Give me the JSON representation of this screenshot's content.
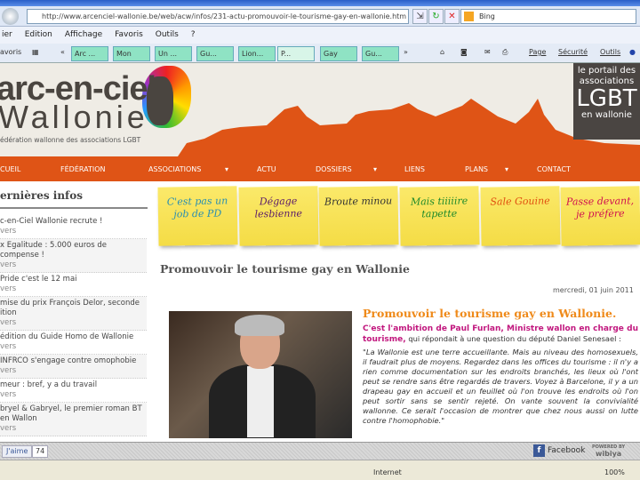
{
  "browser": {
    "url": "http://www.arcenciel-wallonie.be/web/acw/infos/231-actu-promouvoir-le-tourisme-gay-en-wallonie.htm",
    "search_placeholder": "Bing",
    "menu": [
      "ier",
      "Edition",
      "Affichage",
      "Favoris",
      "Outils",
      "?"
    ],
    "favorites_label": "avoris",
    "tabs": [
      "Arc ...",
      "Mon",
      "Un ...",
      "Gu...",
      "Lion...",
      "P...",
      "Gay",
      "Gu..."
    ],
    "tools": [
      "Page",
      "Sécurité",
      "Outils"
    ],
    "status_zone": "Internet",
    "zoom": "100%"
  },
  "site": {
    "logo_line1": "arc-en-ciel",
    "logo_line2": "Wallonie",
    "tagline": "édération wallonne des associations LGBT",
    "portal": [
      "le portail des",
      "associations",
      "LGBT",
      "en wallonie"
    ],
    "nav": [
      "CUEIL",
      "FÉDÉRATION",
      "ASSOCIATIONS",
      "ACTU",
      "DOSSIERS",
      "LIENS",
      "PLANS",
      "CONTACT"
    ]
  },
  "sidebar": {
    "title": "ernières infos",
    "items": [
      {
        "title": "c-en-Ciel Wallonie recrute !",
        "more": "vers"
      },
      {
        "title": "x Egalitude : 5.000 euros de compense !",
        "more": "vers"
      },
      {
        "title": "Pride c'est le 12 mai",
        "more": "vers"
      },
      {
        "title": "mise du prix François Delor, seconde ition",
        "more": "vers"
      },
      {
        "title": "édition du Guide Homo de Wallonie",
        "more": "vers"
      },
      {
        "title": "INFRCO s'engage contre omophobie",
        "more": "vers"
      },
      {
        "title": "meur : bref, y a du travail",
        "more": "vers"
      },
      {
        "title": "bryel & Gabryel, le premier roman BT en Wallon",
        "more": "vers"
      }
    ]
  },
  "stickies": [
    {
      "text": "C'est pas un job de PD",
      "color": "#2a8fb0"
    },
    {
      "text": "Dégage lesbienne",
      "color": "#5a1a6a"
    },
    {
      "text": "Broute minou",
      "color": "#333333"
    },
    {
      "text": "Mais tiiiiire tapette",
      "color": "#1f8a2a"
    },
    {
      "text": "Sale Gouine",
      "color": "#e05010"
    },
    {
      "text": "Passe devant, je préfère",
      "color": "#d01050"
    }
  ],
  "article": {
    "page_title": "Promouvoir le tourisme gay en Wallonie",
    "date": "mercredi, 01 juin 2011",
    "heading": "Promouvoir le tourisme gay en Wallonie.",
    "intro_highlight": "C'est l'ambition de Paul Furlan, Ministre wallon en charge du tourisme,",
    "intro_rest": " qui répondait à une question du député Daniel Senesael :",
    "quote": "\"La Wallonie est une terre accueillante. Mais au niveau des homosexuels, il faudrait plus de moyens. Regardez dans les offices du tourisme : il n'y a rien comme documentation sur les endroits branchés, les lieux où l'ont peut se rendre sans être regardés de travers. Voyez à Barcelone, il y a un drapeau gay en accueil et un feuillet où l'on trouve les endroits où l'on peut sortir sans se sentir rejeté. On vante souvent la convivialité wallonne. Ce serait l'occasion de montrer que chez nous aussi on lutte contre l'homophobie.\""
  },
  "wibiya": {
    "like": "J'aime",
    "like_count": "74",
    "facebook": "Facebook",
    "powered": "POWERED BY",
    "brand": "wibiya"
  }
}
